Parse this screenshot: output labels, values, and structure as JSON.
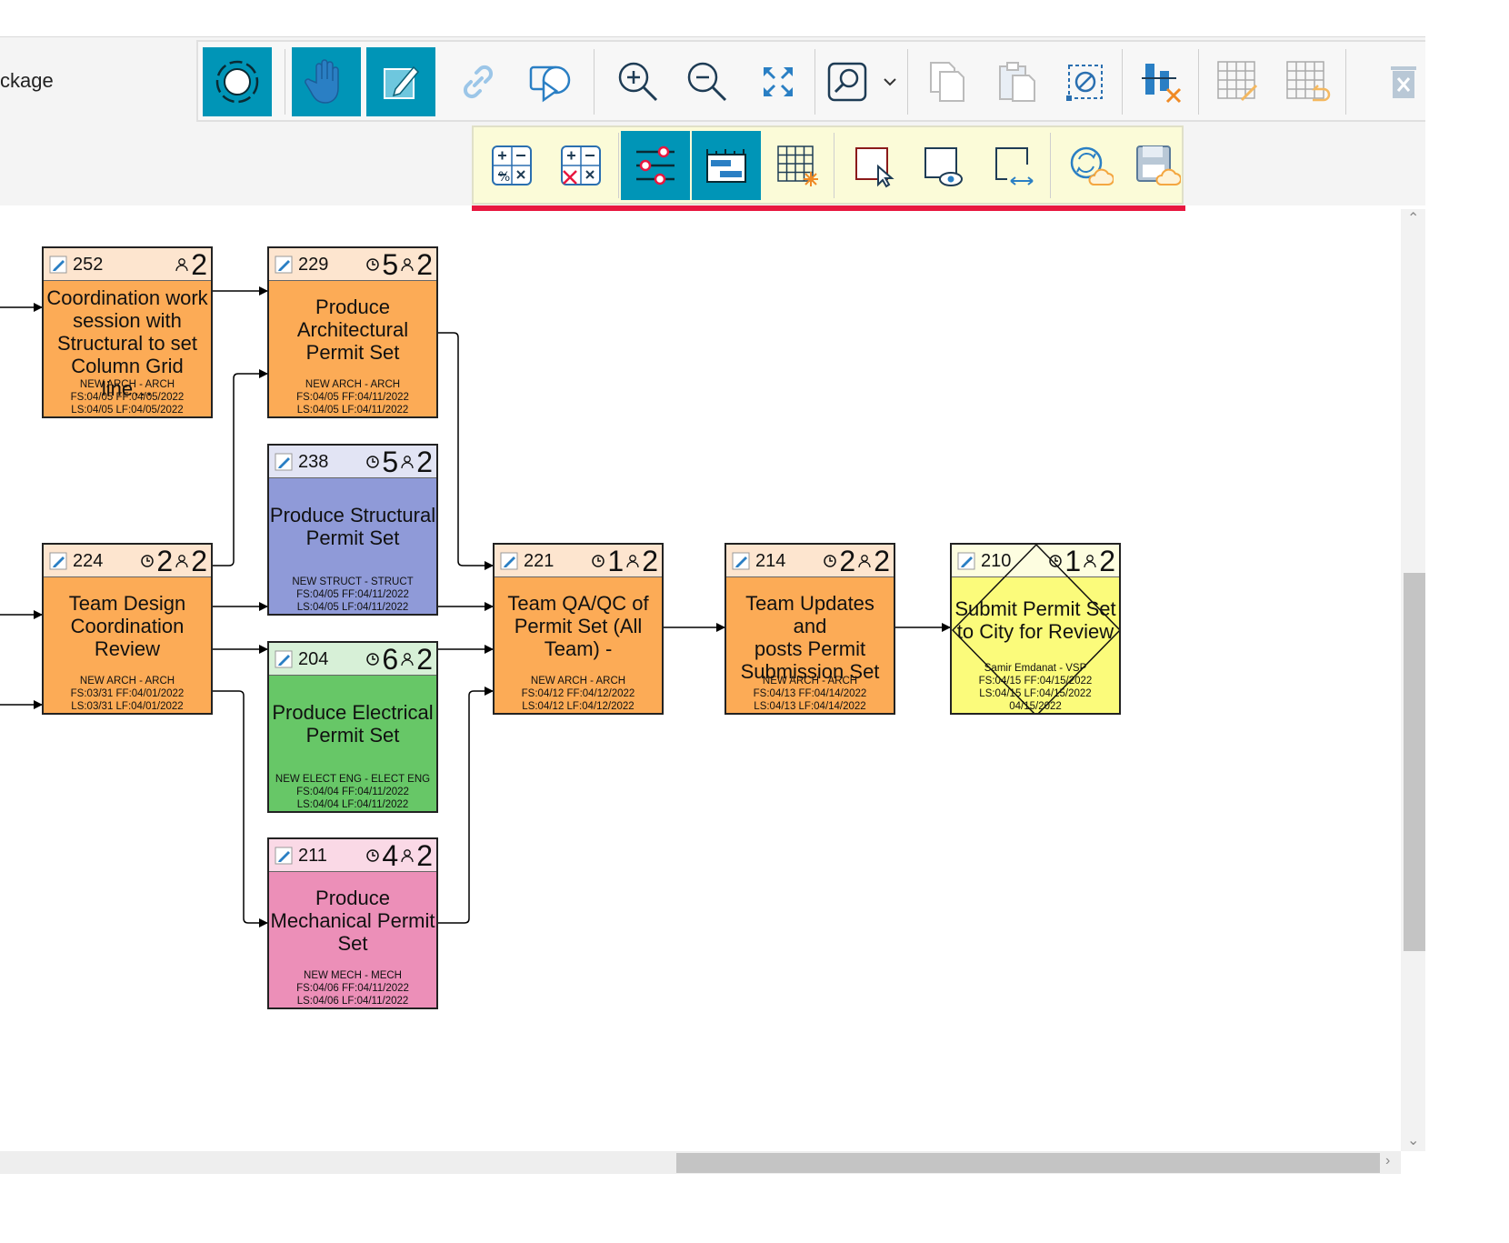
{
  "header": {
    "package_label": "ckage"
  },
  "toolbar": {
    "buttons": [
      {
        "name": "select-ring",
        "active": true
      },
      {
        "name": "pan-hand",
        "active": true
      },
      {
        "name": "edit-pencil",
        "active": true
      },
      {
        "name": "link",
        "active": false
      },
      {
        "name": "play-present",
        "active": false
      },
      {
        "name": "zoom-in",
        "active": false
      },
      {
        "name": "zoom-out",
        "active": false
      },
      {
        "name": "fit-screen",
        "active": false
      },
      {
        "name": "search-dropdown",
        "active": false
      },
      {
        "name": "copy",
        "active": false
      },
      {
        "name": "paste",
        "active": false
      },
      {
        "name": "clear-selection",
        "active": false
      },
      {
        "name": "align-delete",
        "active": false
      },
      {
        "name": "grid-magic",
        "active": false
      },
      {
        "name": "grid-undo",
        "active": false
      },
      {
        "name": "trash",
        "active": false
      }
    ]
  },
  "toolbar2": {
    "buttons": [
      {
        "name": "calculator",
        "active": false
      },
      {
        "name": "calculator-delete",
        "active": false
      },
      {
        "name": "sliders",
        "active": true
      },
      {
        "name": "timeline-ruler",
        "active": true
      },
      {
        "name": "grid-star",
        "active": false
      },
      {
        "name": "select-region",
        "active": false
      },
      {
        "name": "view-region",
        "active": false
      },
      {
        "name": "resize-region",
        "active": false
      },
      {
        "name": "cloud-sync",
        "active": false
      },
      {
        "name": "cloud-save",
        "active": false
      }
    ]
  },
  "colors": {
    "accent": "#0095b7",
    "highlight_bar": "#e8173f",
    "arch_body": "#fcab56",
    "arch_head": "#fde5cf",
    "struct_body": "#8f9ad8",
    "struct_head": "#e2e4f4",
    "elect_body": "#67c767",
    "elect_head": "#d7f0d7",
    "mech_body": "#ec8fb8",
    "mech_head": "#fad9e6",
    "milestone_body": "#fbfb7b",
    "milestone_head": "#fdfde0"
  },
  "nodes": [
    {
      "id": "252",
      "duration": "",
      "resources": "2",
      "title": [
        "Coordination work",
        "session with",
        "Structural to set",
        "Column Grid line…"
      ],
      "meta": [
        "NEW ARCH - ARCH",
        "FS:04/05 FF:04/05/2022",
        "LS:04/05 LF:04/05/2022"
      ],
      "type": "arch"
    },
    {
      "id": "229",
      "duration": "5",
      "resources": "2",
      "title": [
        "Produce",
        "Architectural",
        "Permit Set"
      ],
      "meta": [
        "NEW ARCH - ARCH",
        "FS:04/05 FF:04/11/2022",
        "LS:04/05 LF:04/11/2022"
      ],
      "type": "arch"
    },
    {
      "id": "238",
      "duration": "5",
      "resources": "2",
      "title": [
        "Produce Structural",
        "Permit Set"
      ],
      "meta": [
        "NEW STRUCT - STRUCT",
        "FS:04/05 FF:04/11/2022",
        "LS:04/05 LF:04/11/2022"
      ],
      "type": "struct"
    },
    {
      "id": "224",
      "duration": "2",
      "resources": "2",
      "title": [
        "Team Design",
        "Coordination",
        "Review"
      ],
      "meta": [
        "NEW ARCH - ARCH",
        "FS:03/31 FF:04/01/2022",
        "LS:03/31 LF:04/01/2022"
      ],
      "type": "arch"
    },
    {
      "id": "204",
      "duration": "6",
      "resources": "2",
      "title": [
        "Produce Electrical",
        "Permit Set"
      ],
      "meta": [
        "NEW ELECT ENG - ELECT ENG",
        "FS:04/04 FF:04/11/2022",
        "LS:04/04 LF:04/11/2022"
      ],
      "type": "elect"
    },
    {
      "id": "211",
      "duration": "4",
      "resources": "2",
      "title": [
        "Produce",
        "Mechanical Permit",
        "Set"
      ],
      "meta": [
        "NEW MECH - MECH",
        "FS:04/06 FF:04/11/2022",
        "LS:04/06 LF:04/11/2022"
      ],
      "type": "mech"
    },
    {
      "id": "221",
      "duration": "1",
      "resources": "2",
      "title": [
        "Team QA/QC of",
        "Permit Set (All",
        "Team) -"
      ],
      "meta": [
        "NEW ARCH - ARCH",
        "FS:04/12 FF:04/12/2022",
        "LS:04/12 LF:04/12/2022"
      ],
      "type": "arch"
    },
    {
      "id": "214",
      "duration": "2",
      "resources": "2",
      "title": [
        "Team Updates and",
        "posts Permit",
        "Submission Set"
      ],
      "meta": [
        "NEW ARCH - ARCH",
        "FS:04/13 FF:04/14/2022",
        "LS:04/13 LF:04/14/2022"
      ],
      "type": "arch"
    },
    {
      "id": "210",
      "duration": "1",
      "resources": "2",
      "title": [
        "Submit Permit Set",
        "to City for Review"
      ],
      "meta": [
        "Samir Emdanat - VSP",
        "FS:04/15 FF:04/15/2022",
        "LS:04/15 LF:04/15/2022",
        "04/15/2022"
      ],
      "type": "milestone"
    }
  ]
}
